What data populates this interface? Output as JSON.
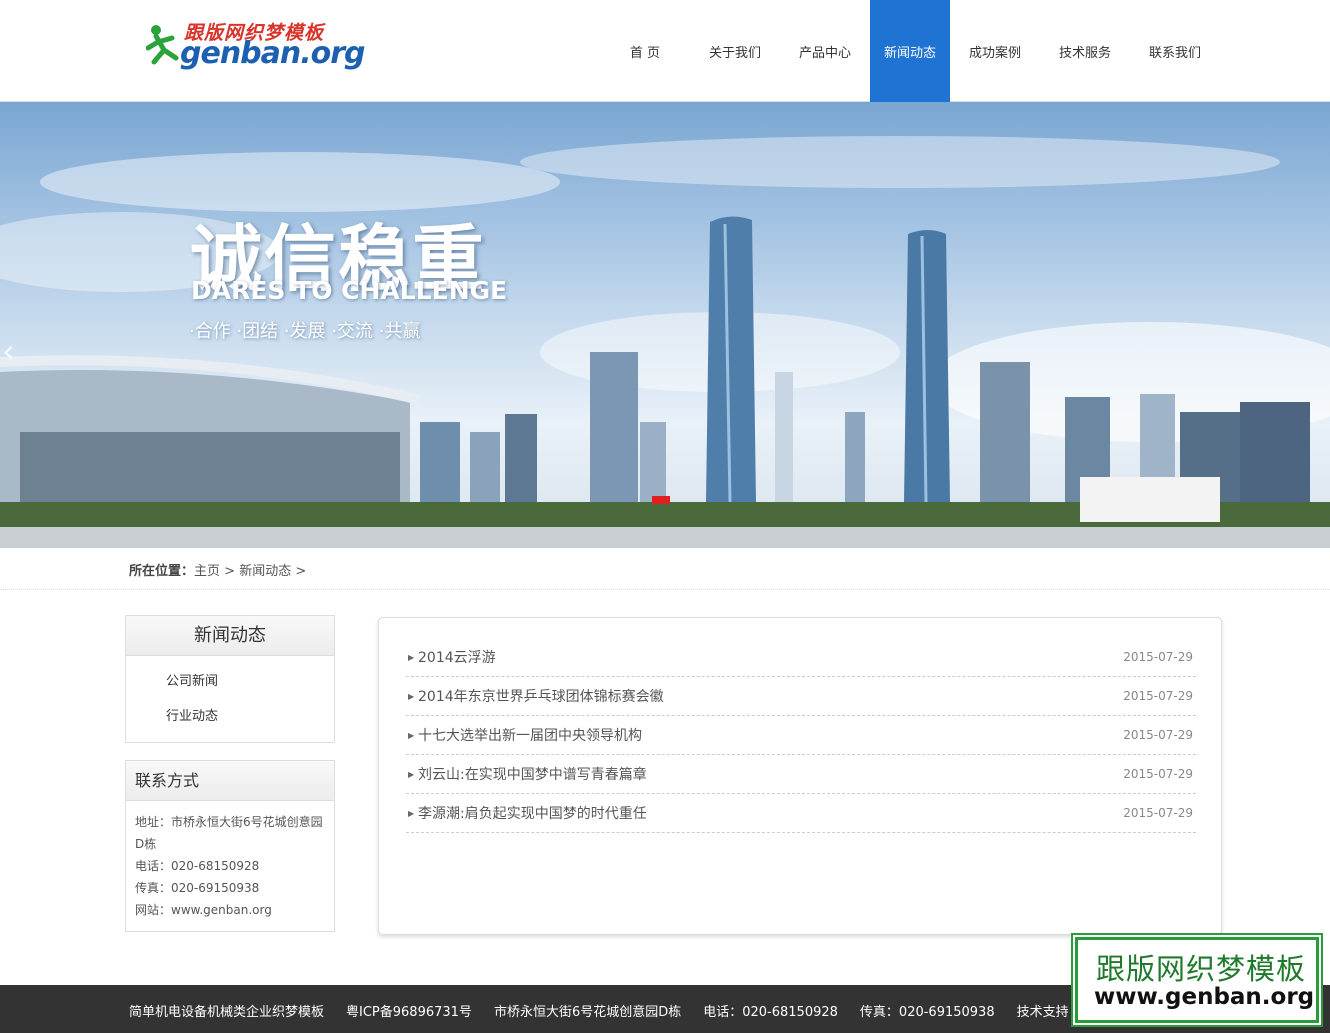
{
  "header": {
    "logo_cn": "跟版网织梦模板",
    "logo_en": "genban.org",
    "nav": [
      "首 页",
      "关于我们",
      "产品中心",
      "新闻动态",
      "成功案例",
      "技术服务",
      "联系我们"
    ],
    "active_nav": "新闻动态"
  },
  "banner": {
    "slogan_cn": "诚信稳重",
    "slogan_en": "DARES TO CHALLENGE",
    "slogan_sub": "·合作 ·团结 ·发展 ·交流 ·共赢",
    "prev_icon": "chevron-left-icon"
  },
  "breadcrumb": {
    "label": "所在位置：",
    "home": "主页",
    "sep1": " > ",
    "current": "新闻动态",
    "sep2": " >"
  },
  "sidebar": {
    "news_title": "新闻动态",
    "news_links": [
      "公司新闻",
      "行业动态"
    ],
    "contact_title": "联系方式",
    "address": "地址：市桥永恒大街6号花城创意园D栋",
    "phone": "电话：020-68150928",
    "fax": "传真：020-69150938",
    "website": "网站：www.genban.org"
  },
  "news": [
    {
      "title": "2014云浮游",
      "date": "2015-07-29"
    },
    {
      "title": "2014年东京世界乒乓球团体锦标赛会徽",
      "date": "2015-07-29"
    },
    {
      "title": "十七大选举出新一届团中央领导机构",
      "date": "2015-07-29"
    },
    {
      "title": "刘云山:在实现中国梦中谱写青春篇章",
      "date": "2015-07-29"
    },
    {
      "title": "李源潮:肩负起实现中国梦的时代重任",
      "date": "2015-07-29"
    }
  ],
  "footer": {
    "items": [
      "简单机电设备机械类企业织梦模板",
      "粤ICP备96896731号",
      "市桥永恒大街6号花城创意园D栋",
      "电话：020-68150928",
      "传真：020-69150938",
      "技术支持 ：织梦模板"
    ]
  },
  "watermark": {
    "cn": "跟版网织梦模板",
    "en": "www.genban.org"
  },
  "colors": {
    "nav_active": "#1f73d3",
    "footer_bg": "#333333",
    "watermark_green": "#2a9b3a"
  }
}
